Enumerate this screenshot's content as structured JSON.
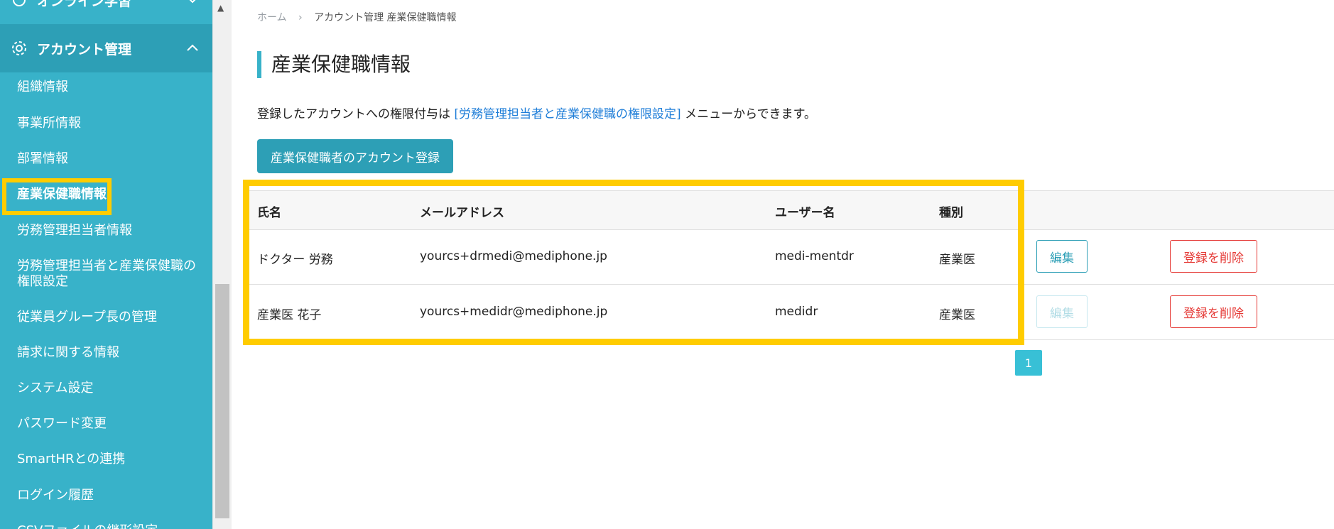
{
  "sidebar": {
    "top_section_label": "オンライン学習",
    "account_section_label": "アカウント管理",
    "items": [
      {
        "label": "組織情報"
      },
      {
        "label": "事業所情報"
      },
      {
        "label": "部署情報"
      },
      {
        "label": "産業保健職情報"
      },
      {
        "label": "労務管理担当者情報"
      },
      {
        "label": "労務管理担当者と産業保健職の\n権限設定"
      },
      {
        "label": "従業員グループ長の管理"
      },
      {
        "label": "請求に関する情報"
      },
      {
        "label": "システム設定"
      },
      {
        "label": "パスワード変更"
      },
      {
        "label": "SmartHRとの連携"
      },
      {
        "label": "ログイン履歴"
      },
      {
        "label": "CSVファイルの継形設定"
      }
    ]
  },
  "breadcrumb": {
    "home": "ホーム",
    "current": "アカウント管理 産業保健職情報"
  },
  "page": {
    "title": "産業保健職情報",
    "desc_prefix": "登録したアカウントへの権限付与は ",
    "desc_link": "[労務管理担当者と産業保健職の権限設定]",
    "desc_suffix": " メニューからできます。",
    "register_button": "産業保健職者のアカウント登録"
  },
  "table": {
    "headers": [
      "氏名",
      "メールアドレス",
      "ユーザー名",
      "種別"
    ],
    "rows": [
      {
        "name": "ドクター 労務",
        "email": "yourcs+drmedi@mediphone.jp",
        "username": "medi-mentdr",
        "type": "産業医",
        "edit": "編集",
        "edit_enabled": true,
        "delete": "登録を削除"
      },
      {
        "name": "産業医 花子",
        "email": "yourcs+medidr@mediphone.jp",
        "username": "medidr",
        "type": "産業医",
        "edit": "編集",
        "edit_enabled": false,
        "delete": "登録を削除"
      }
    ]
  },
  "pagination": {
    "current": "1"
  },
  "colors": {
    "accent": "#38b2c9",
    "highlight": "#ffcc00",
    "danger": "#e53935"
  }
}
